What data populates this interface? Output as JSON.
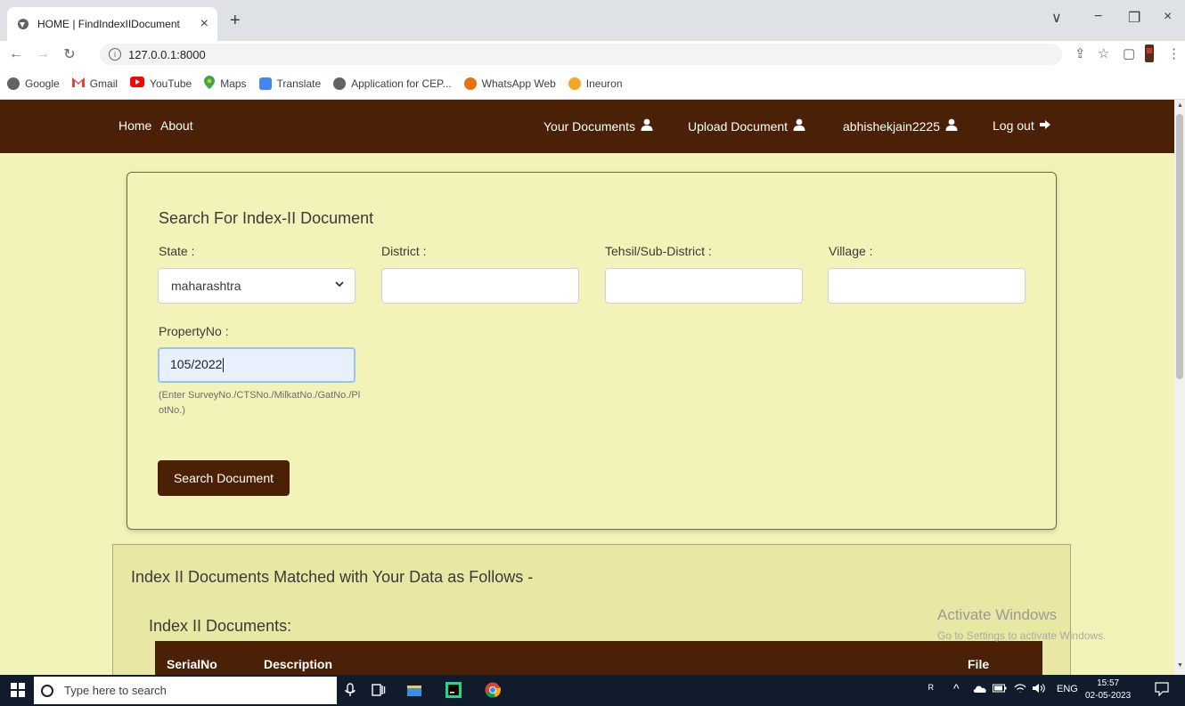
{
  "browser": {
    "tab_title": "HOME | FindIndexIIDocument",
    "tab_close": "×",
    "new_tab": "+",
    "url": "127.0.0.1:8000",
    "window_controls": [
      "∨",
      "−",
      "❐",
      "×"
    ],
    "bookmarks": [
      {
        "label": "Google",
        "icon": "globe-icon",
        "color": "#5f6368"
      },
      {
        "label": "Gmail",
        "icon": "gmail-icon",
        "color": "#ea4335"
      },
      {
        "label": "YouTube",
        "icon": "youtube-icon",
        "color": "#ff0000"
      },
      {
        "label": "Maps",
        "icon": "maps-icon",
        "color": "#34a853"
      },
      {
        "label": "Translate",
        "icon": "translate-icon",
        "color": "#4285f4"
      },
      {
        "label": "Application for CEP...",
        "icon": "globe-icon",
        "color": "#5f6368"
      },
      {
        "label": "WhatsApp Web",
        "icon": "whatsapp-icon",
        "color": "#e8710a"
      },
      {
        "label": "Ineuron",
        "icon": "ineuron-icon",
        "color": "#f5a623"
      }
    ]
  },
  "navbar": {
    "home": "Home",
    "about": "About",
    "your_documents": "Your Documents",
    "upload_document": "Upload Document",
    "username": "abhishekjain2225",
    "logout": "Log out"
  },
  "search_form": {
    "title": "Search For Index-II Document",
    "state_label": "State :",
    "state_value": "maharashtra",
    "district_label": "District :",
    "tehsil_label": "Tehsil/Sub-District :",
    "village_label": "Village :",
    "property_label": "PropertyNo :",
    "property_value": "105/2022",
    "hint": "(Enter SurveyNo./CTSNo./MilkatNo./GatNo./PlotNo.)",
    "button": "Search Document"
  },
  "results": {
    "title": "Index II Documents Matched with Your Data as Follows -",
    "subtitle": "Index II Documents:",
    "columns": [
      "SerialNo",
      "Description",
      "File"
    ]
  },
  "watermark": {
    "line1": "Activate Windows",
    "line2": "Go to Settings to activate Windows."
  },
  "taskbar": {
    "search_placeholder": "Type here to search",
    "lang": "ENG",
    "time": "15:57",
    "date": "02-05-2023"
  },
  "colors": {
    "brand_brown": "#4a2106",
    "page_bg": "#f3f3b9",
    "results_bg": "#e8e7a3"
  }
}
